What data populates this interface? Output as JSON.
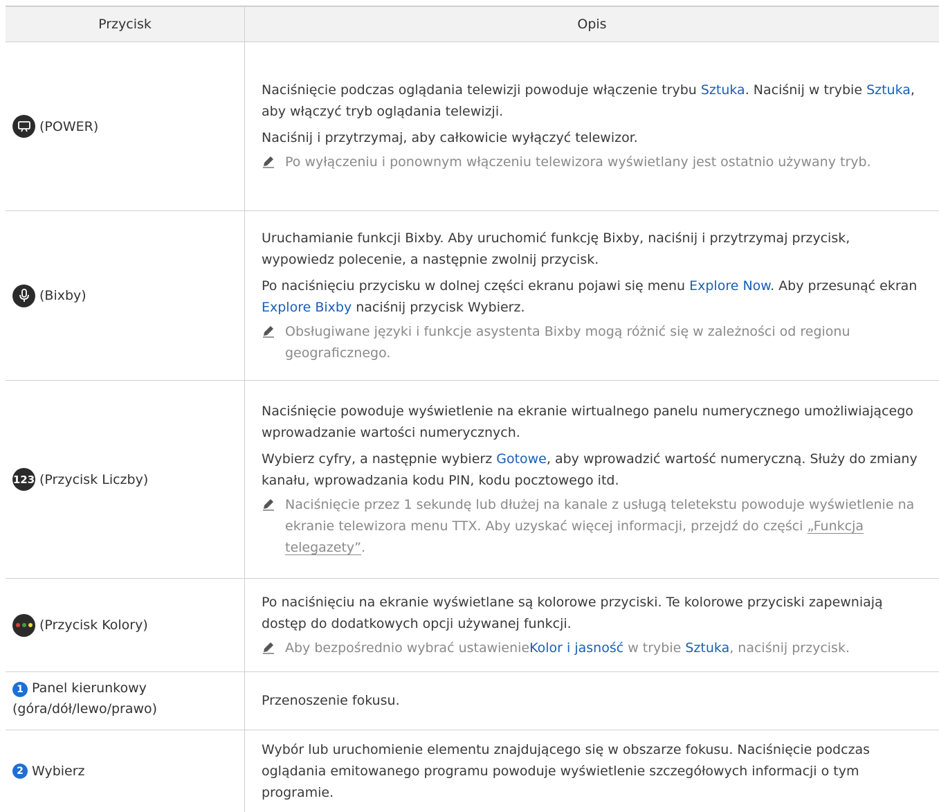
{
  "table": {
    "header": {
      "col1": "Przycisk",
      "col2": "Opis"
    },
    "rows": [
      {
        "icon": "power-art-icon",
        "label": "(POWER)",
        "p1": {
          "a": "Naciśnięcie podczas oglądania telewizji powoduje włączenie trybu ",
          "k1": "Sztuka",
          "b": ". Naciśnij w trybie ",
          "k2": "Sztuka",
          "c": ", aby włączyć tryb oglądania telewizji."
        },
        "p2": "Naciśnij i przytrzymaj, aby całkowicie wyłączyć telewizor.",
        "note": "Po wyłączeniu i ponownym włączeniu telewizora wyświetlany jest ostatnio używany tryb."
      },
      {
        "icon": "microphone-icon",
        "label": "(Bixby)",
        "p1": "Uruchamianie funkcji Bixby. Aby uruchomić funkcję Bixby, naciśnij i przytrzymaj przycisk, wypowiedz polecenie, a następnie zwolnij przycisk.",
        "p2": {
          "a": "Po naciśnięciu przycisku w dolnej części ekranu pojawi się menu ",
          "k1": "Explore Now",
          "b": ". Aby przesunąć ekran ",
          "k2": "Explore Bixby",
          "c": " naciśnij przycisk Wybierz."
        },
        "note": "Obsługiwane języki i funkcje asystenta Bixby mogą różnić się w zależności od regionu geograficznego."
      },
      {
        "icon": "numbers-123-icon",
        "icon_text": "123",
        "label": "(Przycisk Liczby)",
        "p1": "Naciśnięcie powoduje wyświetlenie na ekranie wirtualnego panelu numerycznego umożliwiającego wprowadzanie wartości numerycznych.",
        "p2": {
          "a": "Wybierz cyfry, a następnie wybierz ",
          "k1": "Gotowe",
          "b": ", aby wprowadzić wartość numeryczną. Służy do zmiany kanału, wprowadzania kodu PIN, kodu pocztowego itd."
        },
        "note": {
          "a": "Naciśnięcie przez 1 sekundę lub dłużej na kanale z usługą teletekstu powoduje wyświetlenie na ekranie telewizora menu TTX. Aby uzyskać więcej informacji, przejdź do części ",
          "link": "„Funkcja telegazety”",
          "b": "."
        }
      },
      {
        "icon": "color-buttons-icon",
        "colors": [
          "#e53935",
          "#43a047",
          "#fdd835"
        ],
        "label": "(Przycisk Kolory)",
        "p1": "Po naciśnięciu na ekranie wyświetlane są kolorowe przyciski. Te kolorowe przyciski zapewniają dostęp do dodatkowych opcji używanej funkcji.",
        "note": {
          "a": "Aby bezpośrednio wybrać ustawienie",
          "k1": "Kolor i jasność",
          "b": " w trybie ",
          "k2": "Sztuka",
          "c": ", naciśnij przycisk."
        }
      },
      {
        "num": "1",
        "label": "Panel kierunkowy (góra/dół/lewo/prawo)",
        "p1": "Przenoszenie fokusu."
      },
      {
        "num": "2",
        "label": "Wybierz",
        "p1": "Wybór lub uruchomienie elementu znajdującego się w obszarze fokusu. Naciśnięcie podczas oglądania emitowanego programu powoduje wyświetlenie szczegółowych informacji o tym programie."
      }
    ]
  },
  "colors": {
    "accent": "#1a5fb4",
    "badge": "#1d6fd6",
    "note_text": "#8a8a8a",
    "header_bg": "#f2f2f2",
    "border": "#cfcfcf"
  }
}
